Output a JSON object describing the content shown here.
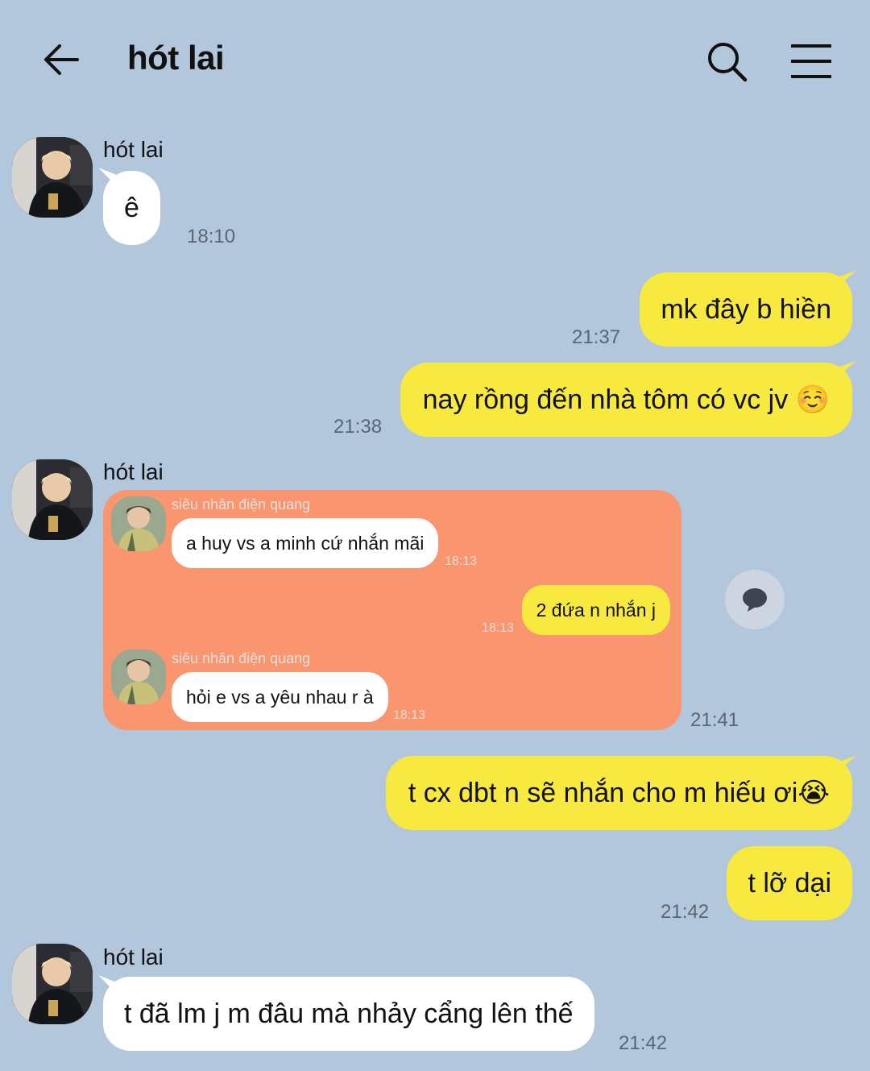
{
  "header": {
    "title": "hót lai",
    "icons": [
      "back-arrow-icon",
      "search-icon",
      "menu-icon"
    ]
  },
  "messages": [
    {
      "type": "incoming",
      "sender": "hót lai",
      "text": "ê",
      "time": "18:10"
    },
    {
      "type": "outgoing",
      "text": "mk đây b hiền",
      "time": "21:37"
    },
    {
      "type": "outgoing",
      "text": "nay rồng đến nhà tôm có vc jv ☺️",
      "time": "21:38"
    },
    {
      "type": "incoming-forwarded",
      "sender": "hót lai",
      "time": "21:41",
      "forwarded": [
        {
          "side": "left",
          "name": "siêu nhân điện quang",
          "text": "a huy vs a minh cứ nhắn mãi",
          "time": "18:13"
        },
        {
          "side": "right",
          "text": "2 đứa n nhắn j",
          "time": "18:13"
        },
        {
          "side": "left",
          "name": "siêu nhân điện quang",
          "text": "hỏi e vs a yêu nhau r à",
          "time": "18:13"
        }
      ]
    },
    {
      "type": "outgoing",
      "text": "t cx dbt n sẽ nhắn cho m hiếu ơi😭",
      "time": ""
    },
    {
      "type": "outgoing",
      "text": "t lỡ dại",
      "time": "21:42"
    },
    {
      "type": "incoming",
      "sender": "hót lai",
      "text": "t đã lm j m đâu mà nhảy cẩng lên thế",
      "time": "21:42"
    }
  ],
  "colors": {
    "background": "#b3c7dc",
    "outgoing_bubble": "#f7e93f",
    "incoming_bubble": "#ffffff",
    "forward_card": "#f99670"
  }
}
